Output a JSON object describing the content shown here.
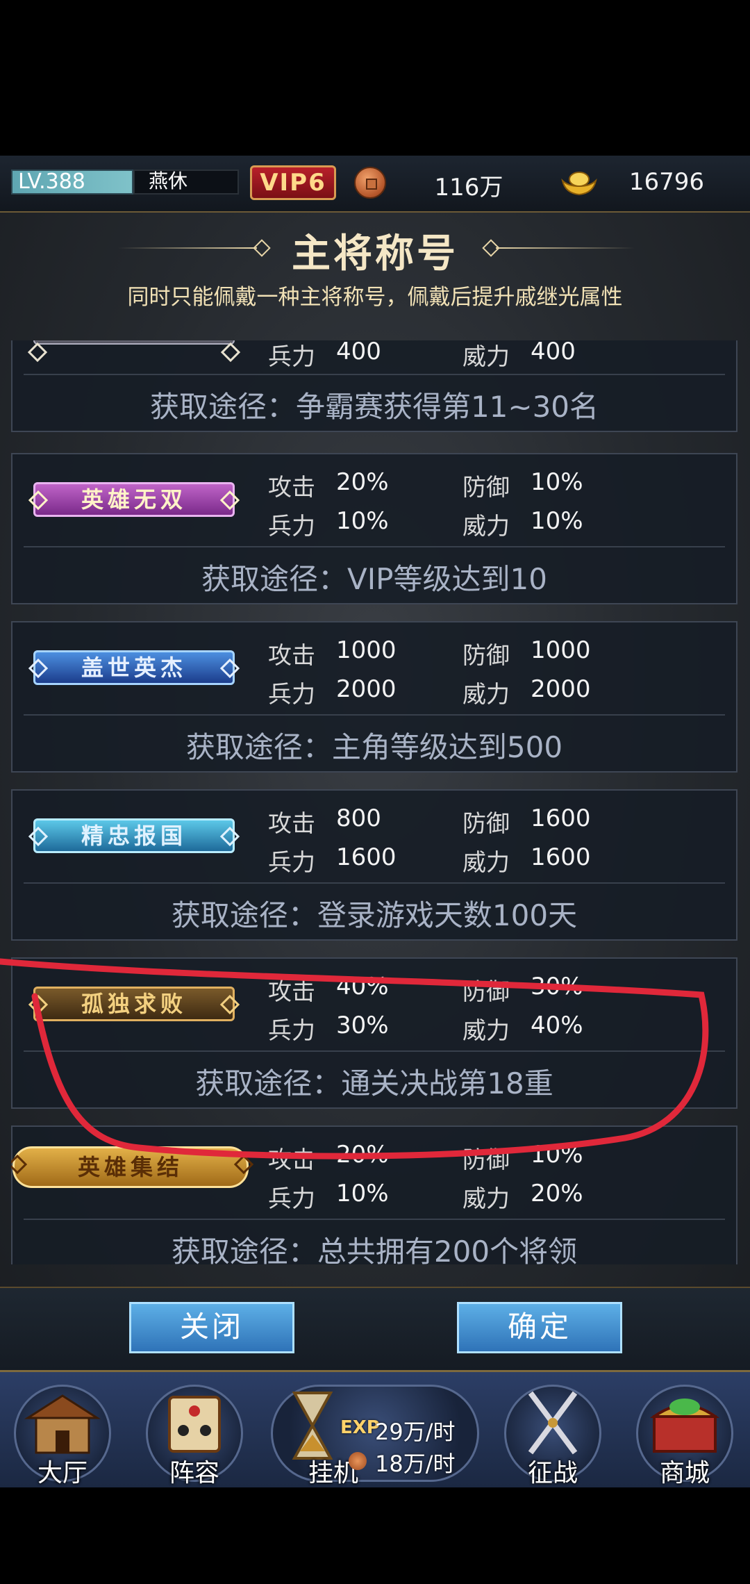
{
  "status_bar": {
    "level": "LV.388",
    "player_name": "燕休",
    "vip": "VIP6",
    "coins": "116万",
    "gold": "16796"
  },
  "panel": {
    "title": "主将称号",
    "subtitle": "同时只能佩戴一种主将称号，佩戴后提升戚继光属性"
  },
  "titles": [
    {
      "badge": "",
      "stats": [
        {
          "label": "兵力",
          "value": "400"
        },
        {
          "label": "威力",
          "value": "400"
        }
      ],
      "source": "获取途径：争霸赛获得第11~30名"
    },
    {
      "badge": "英雄无双",
      "stats": [
        {
          "label": "攻击",
          "value": "20%"
        },
        {
          "label": "防御",
          "value": "10%"
        },
        {
          "label": "兵力",
          "value": "10%"
        },
        {
          "label": "威力",
          "value": "10%"
        }
      ],
      "source": "获取途径：VIP等级达到10"
    },
    {
      "badge": "盖世英杰",
      "stats": [
        {
          "label": "攻击",
          "value": "1000"
        },
        {
          "label": "防御",
          "value": "1000"
        },
        {
          "label": "兵力",
          "value": "2000"
        },
        {
          "label": "威力",
          "value": "2000"
        }
      ],
      "source": "获取途径：主角等级达到500"
    },
    {
      "badge": "精忠报国",
      "stats": [
        {
          "label": "攻击",
          "value": "800"
        },
        {
          "label": "防御",
          "value": "1600"
        },
        {
          "label": "兵力",
          "value": "1600"
        },
        {
          "label": "威力",
          "value": "1600"
        }
      ],
      "source": "获取途径：登录游戏天数100天"
    },
    {
      "badge": "孤独求败",
      "stats": [
        {
          "label": "攻击",
          "value": "40%"
        },
        {
          "label": "防御",
          "value": "30%"
        },
        {
          "label": "兵力",
          "value": "30%"
        },
        {
          "label": "威力",
          "value": "40%"
        }
      ],
      "source": "获取途径：通关决战第18重"
    },
    {
      "badge": "英雄集结",
      "stats": [
        {
          "label": "攻击",
          "value": "20%"
        },
        {
          "label": "防御",
          "value": "10%"
        },
        {
          "label": "兵力",
          "value": "10%"
        },
        {
          "label": "威力",
          "value": "20%"
        }
      ],
      "source": "获取途径：总共拥有200个将领"
    }
  ],
  "buttons": {
    "close": "关闭",
    "confirm": "确定"
  },
  "nav": {
    "hall": "大厅",
    "lineup": "阵容",
    "idle": "挂机",
    "exp_tag": "EXP",
    "exp_rate": "29万/时",
    "coin_rate": "18万/时",
    "battle": "征战",
    "shop": "商城"
  },
  "icons": [
    "coin-icon",
    "gold-ingot-icon",
    "hall-icon",
    "lineup-icon",
    "hourglass-icon",
    "crossed-swords-icon",
    "treasure-chest-icon"
  ],
  "colors": {
    "annotation_red": "#e0283a",
    "vip_red": "#b8202a",
    "button_blue": "#3f8fd4"
  }
}
